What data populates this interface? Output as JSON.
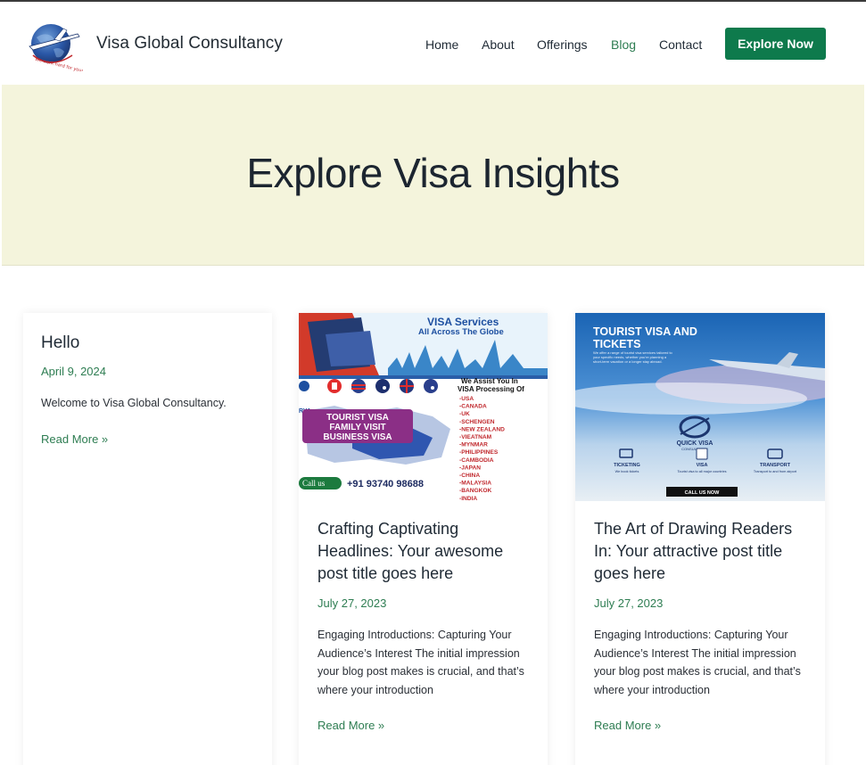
{
  "brand": {
    "name": "Visa Global Consultancy",
    "logo_icon": "globe-airplane-icon",
    "logo_tagline": "We work hard for your dreams"
  },
  "nav": {
    "items": [
      {
        "label": "Home"
      },
      {
        "label": "About"
      },
      {
        "label": "Offerings"
      },
      {
        "label": "Blog",
        "active": true
      },
      {
        "label": "Contact"
      }
    ],
    "cta_label": "Explore Now"
  },
  "hero": {
    "title": "Explore Visa Insights"
  },
  "posts": [
    {
      "title": "Hello",
      "date": "April 9, 2024",
      "excerpt": "Welcome to Visa Global Consultancy.",
      "read_more": "Read More »"
    },
    {
      "title": "Crafting Captivating Headlines: Your awesome post title goes here",
      "date": "July 27, 2023",
      "excerpt": "Engaging Introductions: Capturing Your Audience’s Interest The initial impression your blog post makes is crucial, and that’s where your introduction",
      "read_more": "Read More »",
      "image": {
        "heading_1": "VISA Services",
        "heading_2": "All Across The Globe",
        "assist_1": "We Assist You In",
        "assist_2": "VISA Processing Of",
        "countries": [
          "-USA",
          "-CANADA",
          "-UK",
          "-SCHENGEN",
          "-NEW ZEALAND",
          "-VIEATNAM",
          "-MYNMAR",
          "-PHILIPPINES",
          "-CAMBODIA",
          "-JAPAN",
          "-CHINA",
          "-MALAYSIA",
          "-BANGKOK",
          "-INDIA"
        ],
        "badge_lines": [
          "TOURIST VISA",
          "FAMILY VISIT",
          "BUSINESS VISA"
        ],
        "call_label": "Call us",
        "phone": "+91 93740 98688",
        "partial_brand": "RYA"
      }
    },
    {
      "title": "The Art of Drawing Readers In: Your attractive post title goes here",
      "date": "July 27, 2023",
      "excerpt": "Engaging Introductions: Capturing Your Audience’s Interest The initial impression your blog post makes is crucial, and that’s where your introduction",
      "read_more": "Read More »",
      "image": {
        "heading_1": "TOURIST VISA AND",
        "heading_2": "TICKETS",
        "blurb": "We offer a range of tourist visa services tailored to your specific needs, whether you're planning a short-term vacation or a longer stay abroad.",
        "logo_name": "QUICK VISA",
        "logo_sub": "CONSULTANCY",
        "features": [
          {
            "label": "TICKETING",
            "sub": "We book tickets",
            "icon": "ticket-icon"
          },
          {
            "label": "VISA",
            "sub": "Tourist visa to all major countries",
            "icon": "passport-icon"
          },
          {
            "label": "TRANSPORT",
            "sub": "Transport to and from airport",
            "icon": "bus-icon"
          }
        ],
        "call_button": "CALL US NOW"
      }
    }
  ],
  "colors": {
    "accent": "#0e7a4c",
    "link": "#2e7d52",
    "hero_bg": "#f4f4dc",
    "text": "#1c2530"
  }
}
